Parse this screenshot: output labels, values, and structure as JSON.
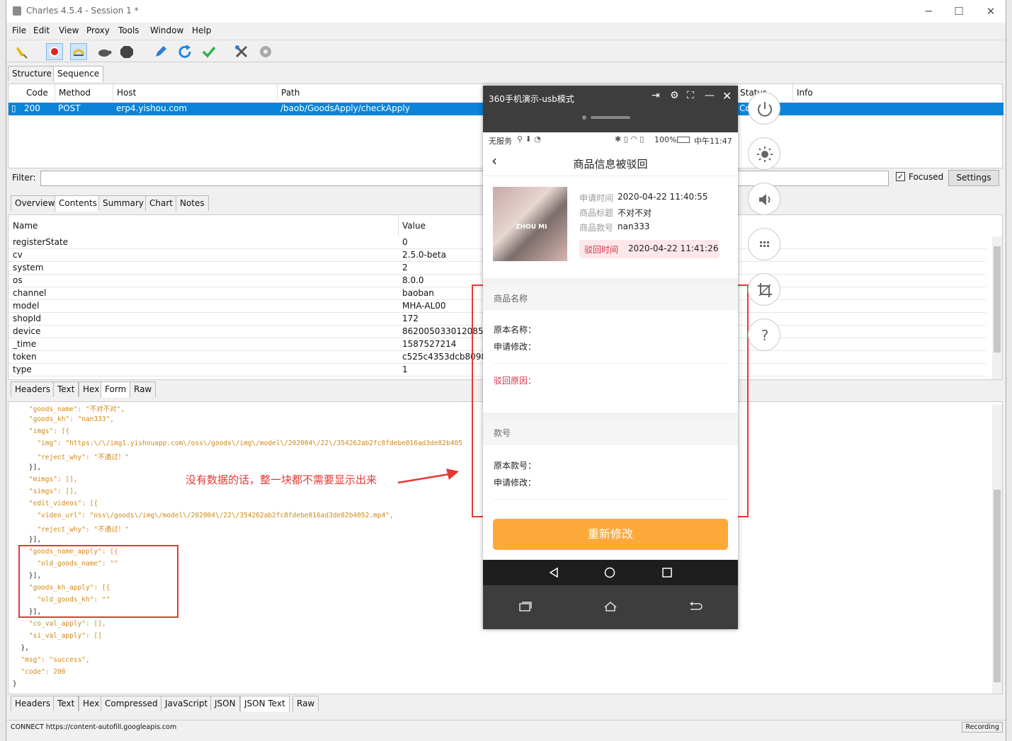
{
  "window": {
    "title": "Charles 4.5.4 - Session 1 *",
    "controls": [
      "─",
      "☐",
      "✕"
    ]
  },
  "menu": [
    "File",
    "Edit",
    "View",
    "Proxy",
    "Tools",
    "Window",
    "Help"
  ],
  "top_tabs": [
    "Structure",
    "Sequence"
  ],
  "sequence_table": {
    "columns": [
      "Code",
      "Method",
      "Host",
      "Path",
      "Status",
      "Info"
    ],
    "row": {
      "code": "200",
      "method": "POST",
      "host": "erp4.yishou.com",
      "path": "/baob/GoodsApply/checkApply",
      "status": "Co"
    }
  },
  "filter": {
    "label": "Filter:",
    "focused_label": "Focused",
    "settings_label": "Settings"
  },
  "detail_tabs": [
    "Overview",
    "Contents",
    "Summary",
    "Chart",
    "Notes"
  ],
  "form_table": {
    "columns": [
      "Name",
      "Value"
    ],
    "rows": [
      [
        "registerState",
        "0"
      ],
      [
        "cv",
        "2.5.0-beta"
      ],
      [
        "system",
        "2"
      ],
      [
        "os",
        "8.0.0"
      ],
      [
        "channel",
        "baoban"
      ],
      [
        "model",
        "MHA-AL00"
      ],
      [
        "shopId",
        "172"
      ],
      [
        "device",
        "862005033012085"
      ],
      [
        "_time",
        "1587527214"
      ],
      [
        "token",
        "c525c4353dcb80981"
      ],
      [
        "type",
        "1"
      ]
    ]
  },
  "request_tabs": [
    "Headers",
    "Text",
    "Hex",
    "Form",
    "Raw"
  ],
  "json_lines": [
    "    \"goods_name\": \"不对不对\",",
    "    \"goods_kh\": \"nan333\",",
    "    \"imgs\": [{",
    "      \"img\": \"https:\\/\\/img1.yishouapp.com\\/oss\\/goods\\/img\\/model\\/202004\\/22\\/354262ab2fc8fdebe016ad3de82b405",
    "      \"reject_why\": \"不通过！\"",
    "    }],",
    "    \"mimgs\": [],",
    "    \"simgs\": [],",
    "    \"edit_videos\": [{",
    "      \"video_url\": \"oss\\/goods\\/img\\/model\\/202004\\/22\\/354262ab2fc8fdebe016ad3de82b4052.mp4\",",
    "      \"reject_why\": \"不通过！\"",
    "    }],",
    "    \"goods_name_apply\": [{",
    "      \"old_goods_name\": \"\"",
    "    }],",
    "    \"goods_kh_apply\": [{",
    "      \"old_goods_kh\": \"\"",
    "    }],",
    "    \"co_val_apply\": [],",
    "    \"si_val_apply\": []",
    "  },",
    "  \"msg\": \"success\",",
    "  \"code\": 200",
    "}"
  ],
  "response_tabs": [
    "Headers",
    "Text",
    "Hex",
    "Compressed",
    "JavaScript",
    "JSON",
    "JSON Text",
    "Raw"
  ],
  "status": {
    "left": "CONNECT https://content-autofill.googleapis.com",
    "right": "Recording"
  },
  "annotation": {
    "text": "没有数据的话，整一块都不需要显示出来",
    "color": "#e53935"
  },
  "phone": {
    "window_title": "360手机演示-usb模式",
    "statusbar_left": "无服务",
    "statusbar_right": "100%",
    "clock": "中午11:47",
    "page_title": "商品信息被驳回",
    "img_text": "ZHOU MI",
    "apply_time_label": "申请时间",
    "apply_time": "2020-04-22 11:40:55",
    "goods_title_label": "商品标题",
    "goods_title": "不对不对",
    "goods_kh_label": "商品款号",
    "goods_kh": "nan333",
    "reject_time_label": "驳回时间",
    "reject_time": "2020-04-22 11:41:26",
    "section1_title": "商品名称",
    "original_name_label": "原本名称：",
    "apply_change_label": "申请修改：",
    "reject_reason_label": "驳回原因：",
    "section2_title": "款号",
    "original_kh_label": "原本款号：",
    "apply_change_label2": "申请修改：",
    "button_label": "重新修改",
    "accent": "#fda93a",
    "reject_color": "#d0344a"
  }
}
